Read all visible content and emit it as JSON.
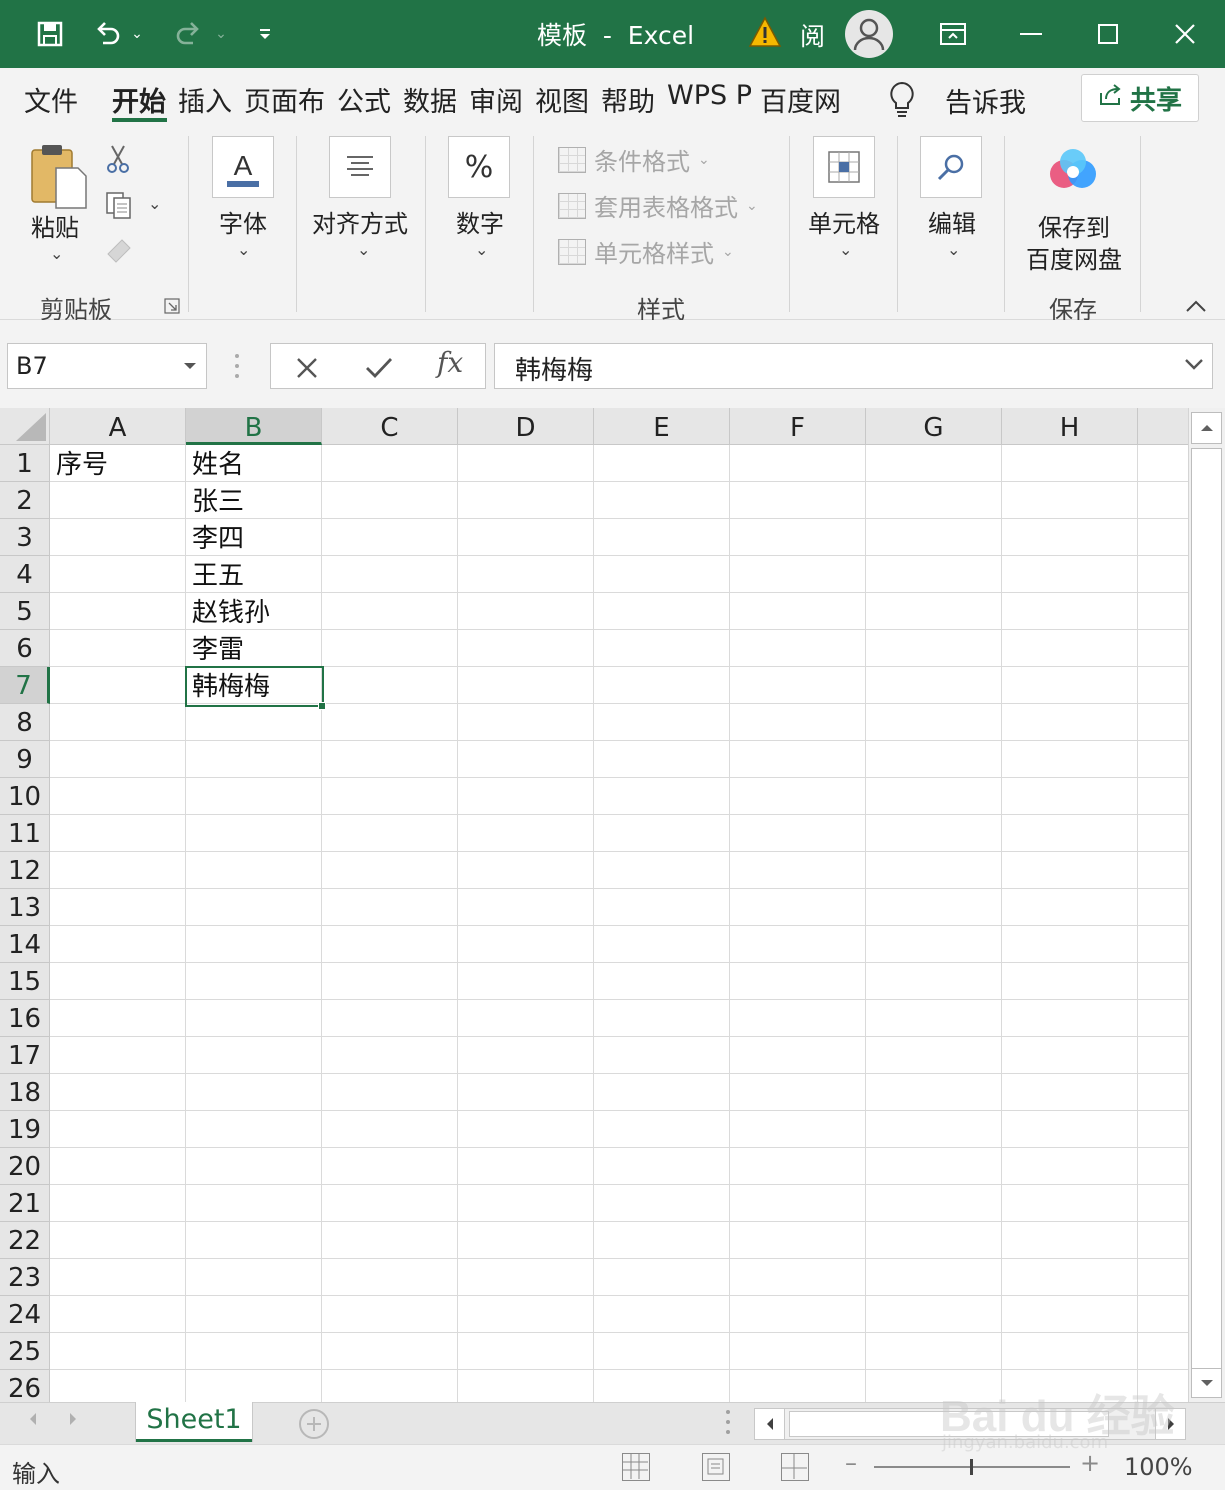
{
  "titlebar": {
    "title": "模板  -  Excel",
    "reader_mode": "阅",
    "save_icon": "save-icon",
    "undo_icon": "undo-icon",
    "redo_icon": "redo-icon",
    "colors": {
      "bar": "#217346",
      "text": "#ffffff"
    }
  },
  "tabs": [
    {
      "label": "文件",
      "active": false
    },
    {
      "label": "开始",
      "active": true
    },
    {
      "label": "插入",
      "active": false
    },
    {
      "label": "页面布",
      "active": false
    },
    {
      "label": "公式",
      "active": false
    },
    {
      "label": "数据",
      "active": false
    },
    {
      "label": "审阅",
      "active": false
    },
    {
      "label": "视图",
      "active": false
    },
    {
      "label": "帮助",
      "active": false
    },
    {
      "label": "WPS P",
      "active": false
    },
    {
      "label": "百度网",
      "active": false
    }
  ],
  "tell_me": "告诉我",
  "share": "共享",
  "ribbon": {
    "paste": "粘贴",
    "clipboard_group": "剪贴板",
    "font": "字体",
    "align": "对齐方式",
    "number": "数字",
    "number_symbol": "%",
    "cond_format": "条件格式",
    "table_format": "套用表格格式",
    "cell_styles": "单元格样式",
    "styles_group": "样式",
    "cells": "单元格",
    "editing": "编辑",
    "save_to": "保存到",
    "baidu_pan": "百度网盘",
    "save_group": "保存"
  },
  "formula_bar": {
    "name_box": "B7",
    "fx": "fx",
    "value": "韩梅梅"
  },
  "grid": {
    "columns": [
      "A",
      "B",
      "C",
      "D",
      "E",
      "F",
      "G",
      "H"
    ],
    "selected_column": "B",
    "rows": [
      "1",
      "2",
      "3",
      "4",
      "5",
      "6",
      "7",
      "8",
      "9",
      "10",
      "11",
      "12",
      "13",
      "14",
      "15",
      "16",
      "17",
      "18",
      "19",
      "20",
      "21",
      "22",
      "23",
      "24",
      "25",
      "26"
    ],
    "selected_row": "7",
    "cells": {
      "A1": "序号",
      "B1": "姓名",
      "B2": "张三",
      "B3": "李四",
      "B4": "王五",
      "B5": "赵钱孙",
      "B6": "李雷",
      "B7": "韩梅梅"
    }
  },
  "sheet_tabs": [
    {
      "label": "Sheet1",
      "active": true
    }
  ],
  "status": {
    "mode": "输入",
    "zoom": "100%"
  },
  "watermark": {
    "main": "Bai du 经验",
    "sub": "jingyan.baidu.com"
  }
}
